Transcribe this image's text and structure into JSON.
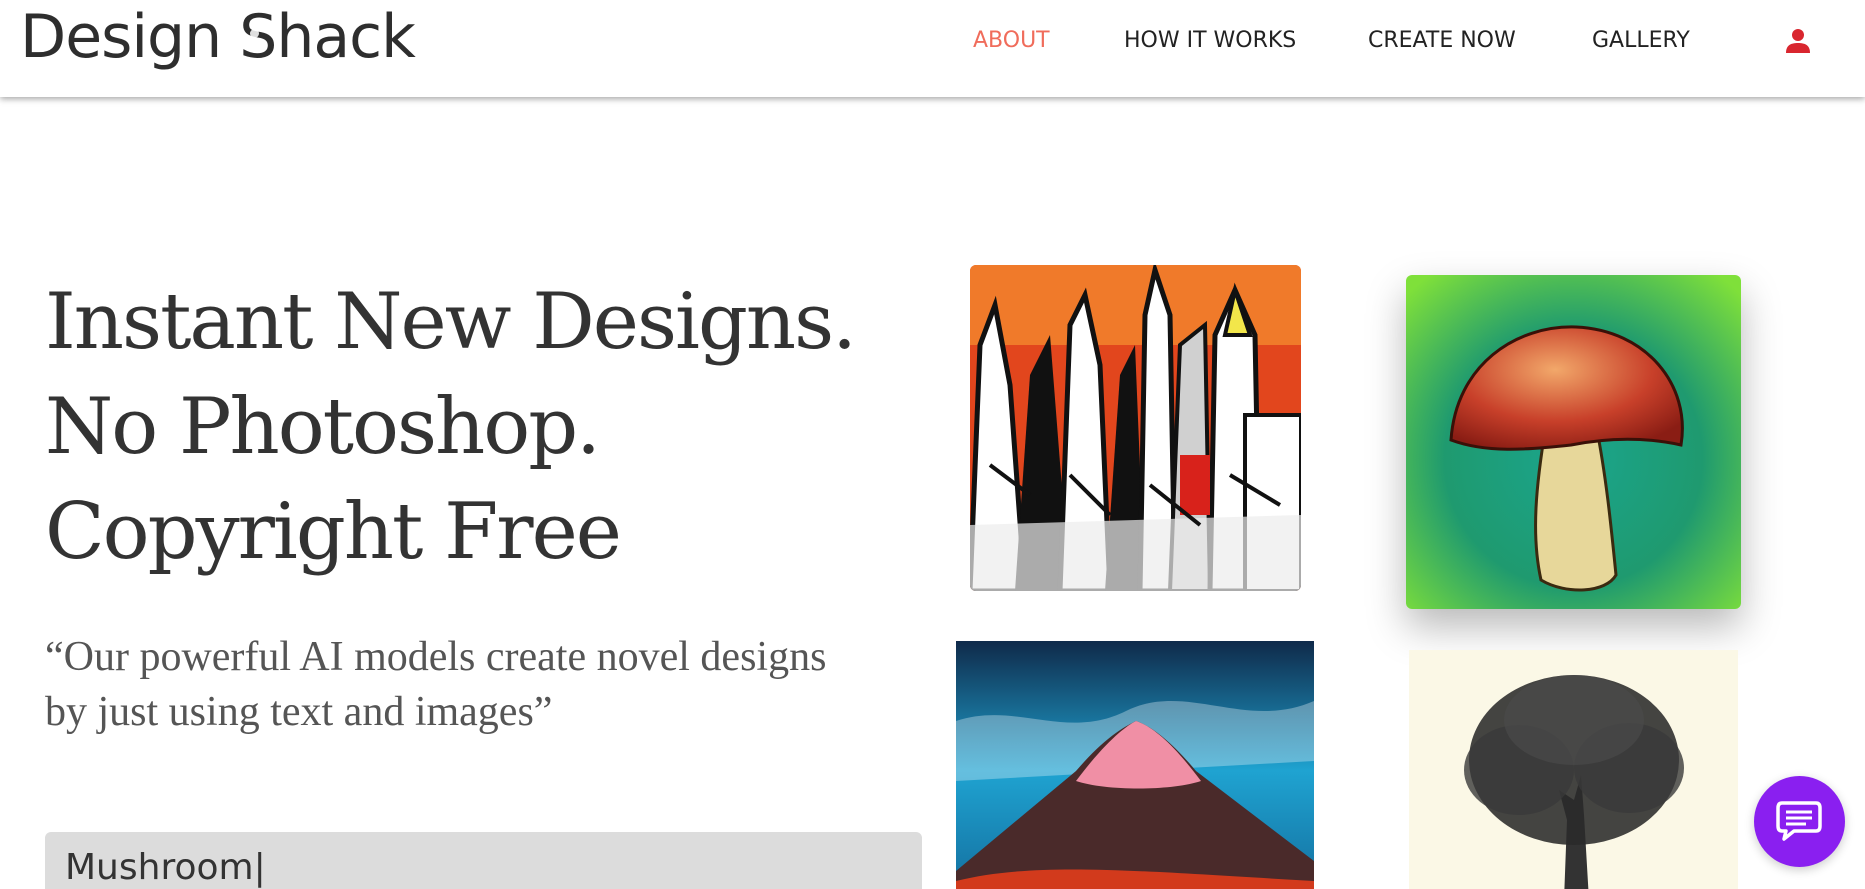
{
  "header": {
    "logo_text_1": "D",
    "logo_text_2": "esign ",
    "logo_text_3": "S",
    "logo_text_4": "hack",
    "nav": [
      {
        "label": "ABOUT",
        "active": true
      },
      {
        "label": "HOW IT WORKS",
        "active": false
      },
      {
        "label": "CREATE NOW",
        "active": false
      },
      {
        "label": "GALLERY",
        "active": false
      }
    ],
    "user_icon": "user-icon"
  },
  "hero": {
    "title_lines": [
      "Instant New Designs.",
      "No Photoshop.",
      "Copyright Free"
    ],
    "quote_line_1": "“Our powerful AI models create novel designs",
    "quote_line_2": "by just using text and images”",
    "input_value": "Mushroom|"
  },
  "gallery": {
    "images": [
      "city-skyline-art",
      "mushroom-watercolor-art",
      "mountain-painting-art",
      "tree-sketch-art"
    ]
  },
  "chat": {
    "icon": "chat-bubble-icon"
  },
  "colors": {
    "accent": "#f06c5b",
    "user_icon": "#d9262f",
    "chat": "#8a1ff0",
    "input_bg": "#dcdcdc"
  }
}
